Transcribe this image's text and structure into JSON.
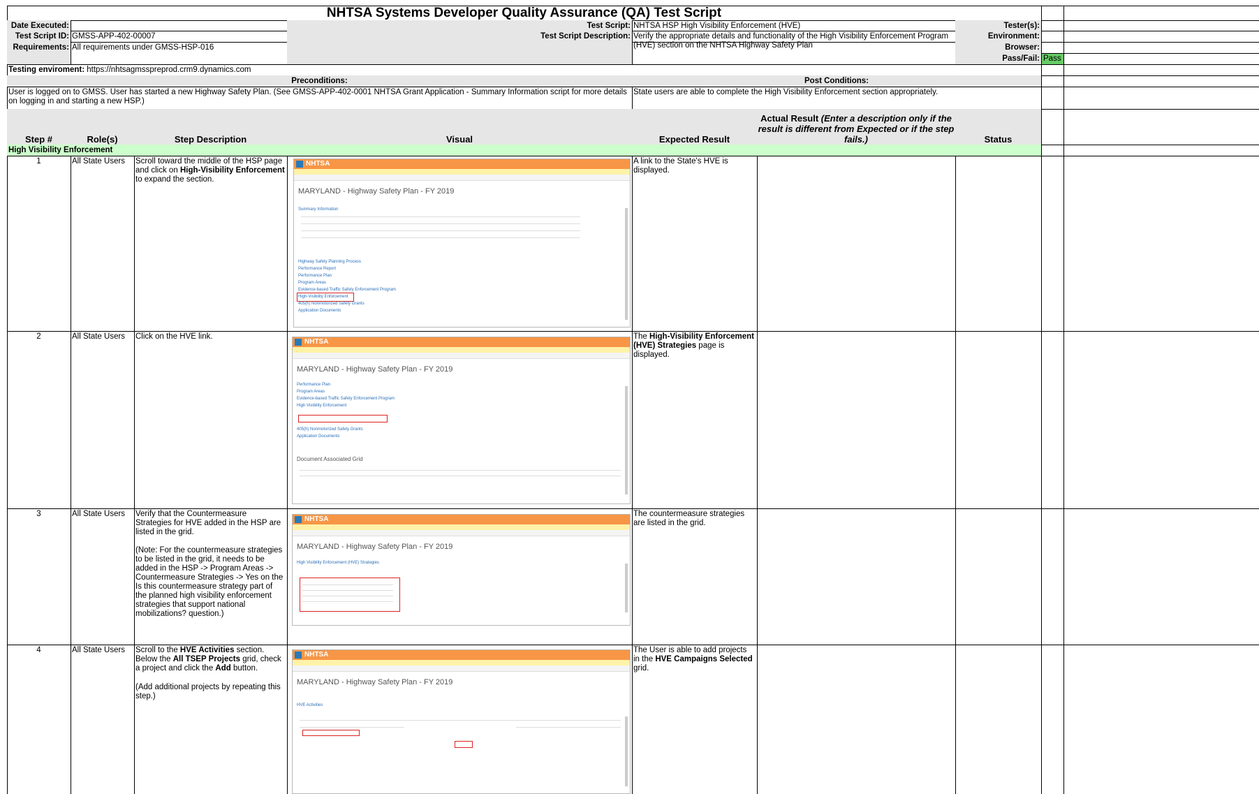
{
  "header": {
    "title": "NHTSA Systems Developer Quality Assurance (QA) Test Script",
    "date_executed_label": "Date Executed:",
    "test_script_id_label": "Test Script ID:",
    "test_script_id": "GMSS-APP-402-00007",
    "requirements_label": "Requirements:",
    "requirements": "All requirements under GMSS-HSP-016",
    "test_script_label": "Test Script:",
    "test_script": "NHTSA HSP High Visibility Enforcement (HVE)",
    "description_label": "Test Script Description:",
    "description": "Verify the appropriate details and functionality of the High Visibility Enforcement Program (HVE) section on the NHTSA Highway Safety Plan",
    "testers_label": "Tester(s):",
    "environment_label": "Environment:",
    "browser_label": "Browser:",
    "passfail_label": "Pass/Fail:",
    "passfail_value": "Pass",
    "testing_env_label": "Testing enviroment:",
    "testing_env": "https://nhtsagmsspreprod.crm9.dynamics.com"
  },
  "conditions": {
    "pre_label": "Preconditions:",
    "pre_text": "User is logged on to GMSS. User has started a new Highway Safety Plan.  (See GMSS-APP-402-0001 NHTSA Grant Application - Summary Information script for more details on logging in and starting a new HSP.)",
    "post_label": "Post Conditions:",
    "post_text": "State users are able to complete the High Visibility Enforcement section appropriately."
  },
  "columns": {
    "step": "Step #",
    "role": "Role(s)",
    "desc": "Step Description",
    "visual": "Visual",
    "expected": "Expected Result",
    "actual_a": "Actual Result ",
    "actual_b": "(Enter a description only if the result is different from Expected or if the step fails.)",
    "status": "Status"
  },
  "section": "High Visibility Enforcement",
  "steps": [
    {
      "num": "1",
      "role": "All State Users",
      "desc_pre": "Scroll toward the middle of the HSP page and click on ",
      "desc_bold": "High-Visibility Enforcement",
      "desc_post": " to expand the section.",
      "expected_pre": "A link to the State's HVE is displayed.",
      "expected_bold": "",
      "expected_post": ""
    },
    {
      "num": "2",
      "role": "All State Users",
      "desc_pre": "Click on the HVE link.",
      "desc_bold": "",
      "desc_post": "",
      "expected_pre": "The ",
      "expected_bold": "High-Visibility Enforcement (HVE) Strategies",
      "expected_post": " page is displayed."
    },
    {
      "num": "3",
      "role": "All State Users",
      "desc_pre": "Verify that the Countermeasure Strategies for HVE added in the HSP are listed in the grid.",
      "desc_note": "(Note: For the countermeasure strategies to be listed in the grid, it needs to be added in the HSP -> Program Areas -> Countermeasure Strategies -> Yes on the Is this countermeasure strategy part of the planned high visibility enforcement strategies that support national mobilizations? question.)",
      "expected_pre": "The countermeasure strategies are listed in the grid."
    },
    {
      "num": "4",
      "role": "All State Users",
      "desc_a": "Scroll to the ",
      "desc_b": "HVE Activities",
      "desc_c": " section. Below the ",
      "desc_d": "All TSEP Projects",
      "desc_e": " grid, check a project and click the ",
      "desc_f": "Add",
      "desc_g": " button.",
      "desc_note": "(Add additional projects by repeating this step.)",
      "expected_pre": "The User is able to add projects in the ",
      "expected_bold": "HVE Campaigns Selected",
      "expected_post": " grid."
    }
  ],
  "screenshots": {
    "logo": "NHTSA",
    "page_title": "MARYLAND - Highway Safety Plan - FY 2019",
    "s1_links": [
      "Summary Information",
      "Highway Safety Planning Process",
      "Performance Report",
      "Performance Plan",
      "Program Areas",
      "Evidence-based Traffic Safety Enforcement Program",
      "High-Visibility Enforcement",
      "405(h) Nonmotorized Safety Grants",
      "Application Documents"
    ],
    "s2_links": [
      "Performance Plan",
      "Program Areas",
      "Evidence-based Traffic Safety Enforcement Program",
      "High Visibility Enforcement"
    ],
    "s2_links_b": [
      "405(h) Nonmotorized Safety Grants",
      "Application Documents"
    ],
    "s2_grid": "Document Associated Grid",
    "s3_section": "High Visibility Enforcement (HVE) Strategies",
    "s4_section": "HVE Activities"
  }
}
